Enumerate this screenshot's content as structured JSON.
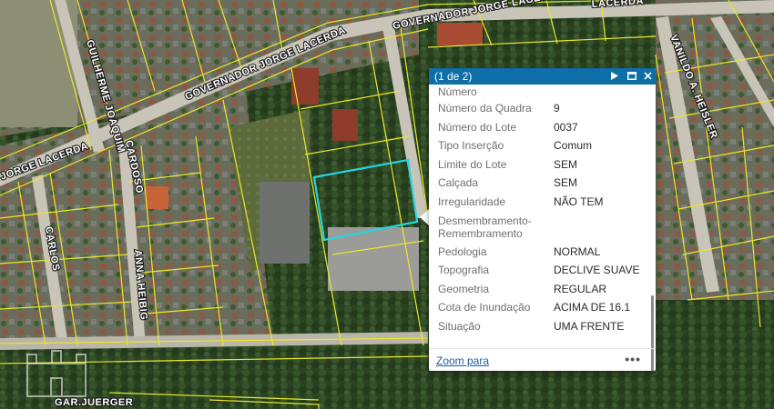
{
  "streets": {
    "governador_top_right": "GOVERNADOR JORGE LACERDA",
    "governador_main": "GOVERNADOR JORGE LACERDA",
    "jorge_lacerda_left": "JORGE LACERDA",
    "guilherme_joaquim": "GUILHERME JOAQUIM",
    "cardoso": "CARDOSO",
    "carlos": "CARLOS",
    "anna_heibig": "ANNA HEIBIG",
    "vanildo": "VANILDO A. HEISLER",
    "lacerda_top": "LACERDA",
    "bottom_partial": "GAR.JUERGER"
  },
  "popup": {
    "pager": "(1 de 2)",
    "next_icon": "play-icon",
    "maximize_icon": "maximize-icon",
    "close_icon": "close-icon",
    "rows": [
      {
        "key": "Número",
        "value": ""
      },
      {
        "key": "Número da Quadra",
        "value": "9"
      },
      {
        "key": "Número do Lote",
        "value": "0037"
      },
      {
        "key": "Tipo Inserção",
        "value": "Comum"
      },
      {
        "key": "Limite do Lote",
        "value": "SEM"
      },
      {
        "key": "Calçada",
        "value": "SEM"
      },
      {
        "key": "Irregularidade",
        "value": "NÃO TEM"
      },
      {
        "key": "Desmembramento-Remembramento",
        "value": ""
      },
      {
        "key": "Pedologia",
        "value": "NORMAL"
      },
      {
        "key": "Topografia",
        "value": "DECLIVE SUAVE"
      },
      {
        "key": "Geometria",
        "value": "REGULAR"
      },
      {
        "key": "Cota de Inundação",
        "value": "ACIMA DE 16.1"
      },
      {
        "key": "Situação",
        "value": "UMA FRENTE"
      }
    ],
    "zoom_label": "Zoom para",
    "more_label": "•••"
  },
  "colors": {
    "parcel_line": "#e8e82a",
    "selected_parcel": "#23d6e0",
    "popup_header": "#0d6ea8",
    "vegetation_dark": "#1f3318",
    "vegetation_mid": "#2f4a24",
    "road": "#c9c4b8"
  }
}
